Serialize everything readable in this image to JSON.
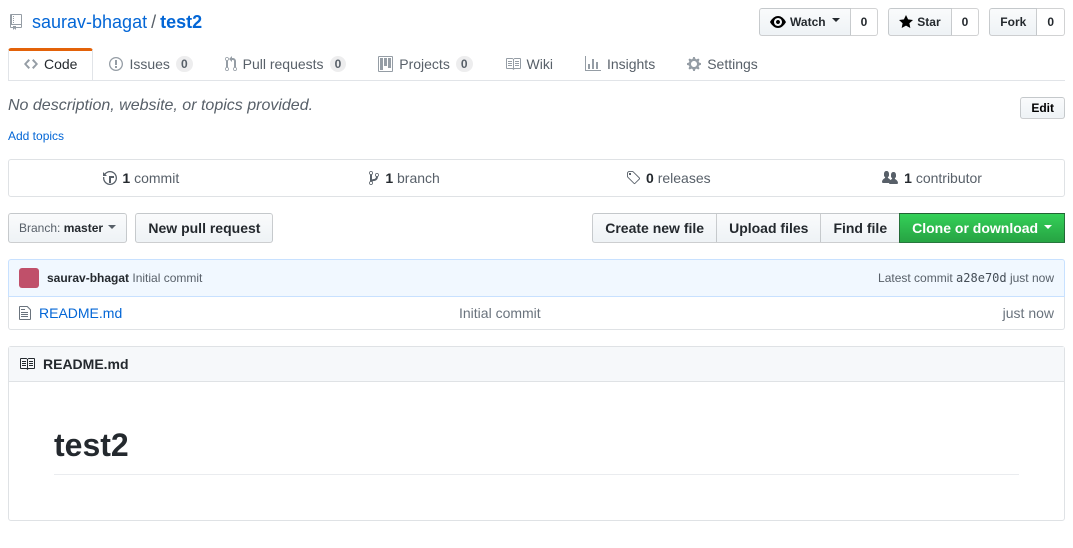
{
  "repo": {
    "owner": "saurav-bhagat",
    "separator": "/",
    "name": "test2"
  },
  "actions": {
    "watch": {
      "label": "Watch",
      "count": "0"
    },
    "star": {
      "label": "Star",
      "count": "0"
    },
    "fork": {
      "label": "Fork",
      "count": "0"
    }
  },
  "tabs": {
    "code": "Code",
    "issues": {
      "label": "Issues",
      "count": "0"
    },
    "pulls": {
      "label": "Pull requests",
      "count": "0"
    },
    "projects": {
      "label": "Projects",
      "count": "0"
    },
    "wiki": "Wiki",
    "insights": "Insights",
    "settings": "Settings"
  },
  "description": {
    "placeholder": "No description, website, or topics provided.",
    "edit": "Edit",
    "add_topics": "Add topics"
  },
  "stats": {
    "commits": {
      "num": "1",
      "label": " commit"
    },
    "branches": {
      "num": "1",
      "label": " branch"
    },
    "releases": {
      "num": "0",
      "label": " releases"
    },
    "contributors": {
      "num": "1",
      "label": " contributor"
    }
  },
  "filenav": {
    "branch_prefix": "Branch: ",
    "branch_name": "master",
    "new_pr": "New pull request",
    "create_file": "Create new file",
    "upload_files": "Upload files",
    "find_file": "Find file",
    "clone": "Clone or download"
  },
  "commit_tease": {
    "author": "saurav-bhagat",
    "message": "Initial commit",
    "latest_label": "Latest commit ",
    "sha": "a28e70d",
    "time_sep": " ",
    "time": "just now"
  },
  "files": [
    {
      "name": "README.md",
      "message": "Initial commit",
      "age": "just now"
    }
  ],
  "readme": {
    "filename": "README.md",
    "heading": "test2"
  }
}
